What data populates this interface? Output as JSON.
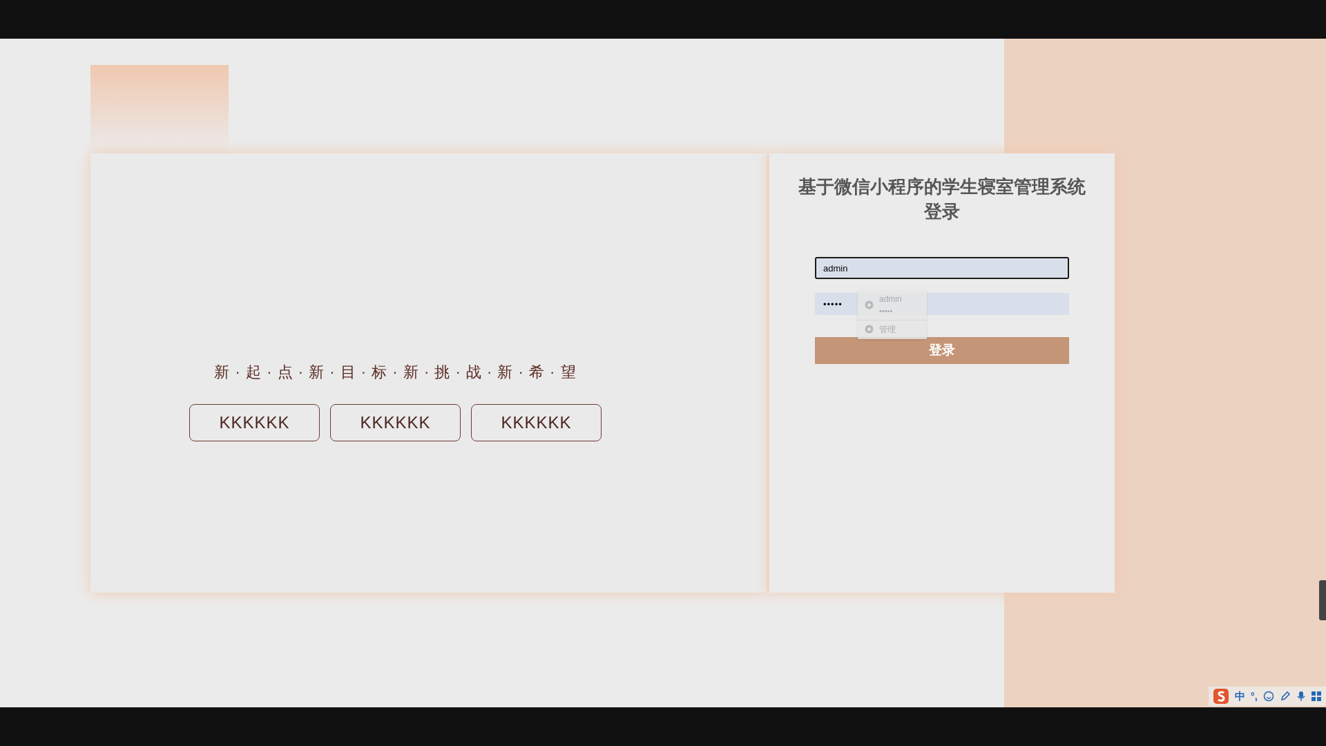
{
  "hero": {
    "slogan": "新 · 起 · 点 · 新 · 目 · 标 · 新 · 挑 · 战 · 新 · 希 · 望",
    "buttons": [
      "KKKKKK",
      "KKKKKK",
      "KKKKKK"
    ]
  },
  "login": {
    "title": "基于微信小程序的学生寝室管理系统登录",
    "fields": [
      {
        "kind": "text",
        "value": "admin",
        "focused": true
      },
      {
        "kind": "password",
        "value": "•••••",
        "focused": false
      }
    ],
    "autofill": [
      {
        "title": "admin",
        "detail": "•••••"
      },
      {
        "title": "管理"
      }
    ],
    "submit": "登录"
  },
  "ime_toolbar": {
    "items": [
      "中",
      "°,"
    ]
  }
}
